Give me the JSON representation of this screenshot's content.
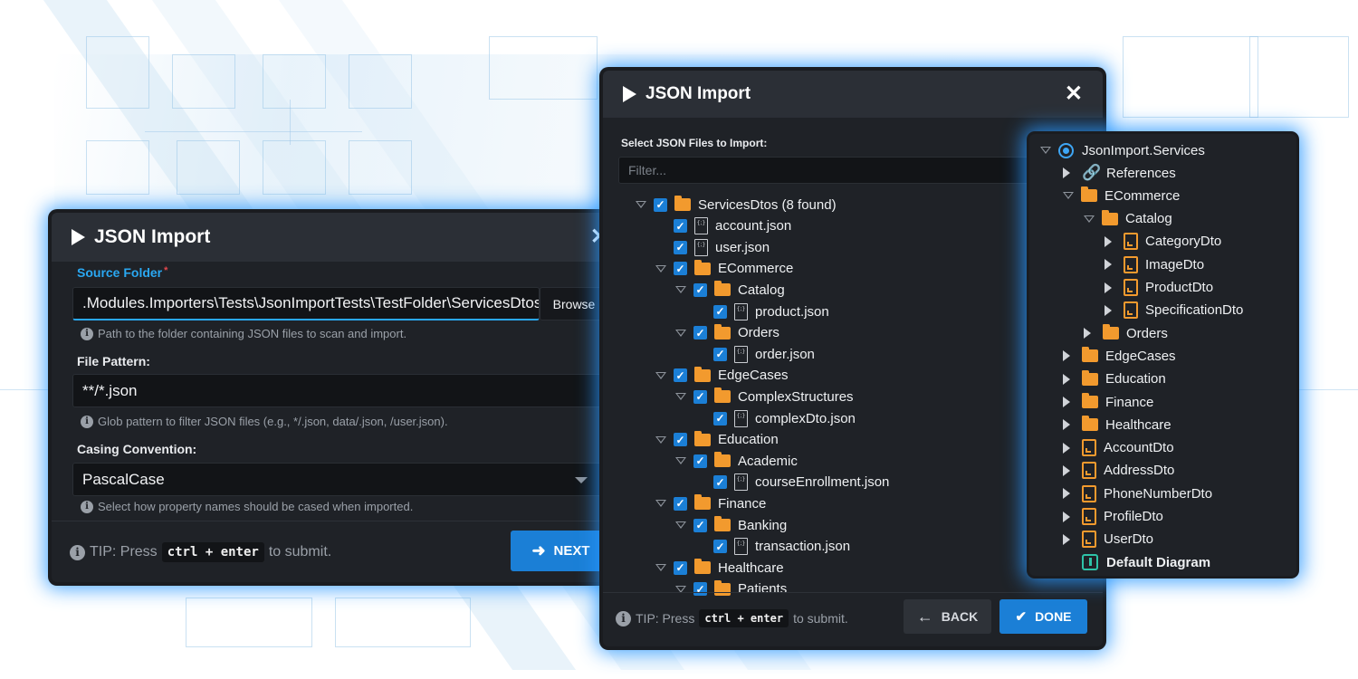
{
  "colors": {
    "accent": "#1b7fd6",
    "glow": "#2896ff",
    "folder": "#f29a2e",
    "required": "#e5484d"
  },
  "dialog_left": {
    "title": "JSON Import",
    "source_folder": {
      "label": "Source Folder",
      "required_mark": "*",
      "value": ".Modules.Importers\\Tests\\JsonImportTests\\TestFolder\\ServicesDtos",
      "browse_label": "Browse",
      "hint": "Path to the folder containing JSON files to scan and import."
    },
    "file_pattern": {
      "label": "File Pattern:",
      "value": "**/*.json",
      "hint": "Glob pattern to filter JSON files (e.g., */.json, data/.json, /user.json)."
    },
    "casing": {
      "label": "Casing Convention:",
      "value": "PascalCase",
      "hint": "Select how property names should be cased when imported."
    },
    "tip": {
      "prefix": "TIP: Press",
      "shortcut": "ctrl + enter",
      "suffix": "to submit."
    },
    "next_label": "NEXT"
  },
  "dialog_middle": {
    "title": "JSON Import",
    "select_label": "Select JSON Files to Import:",
    "filter_placeholder": "Filter...",
    "tree": [
      {
        "label": "ServicesDtos (8 found)",
        "kind": "folder"
      },
      {
        "label": "account.json",
        "kind": "file"
      },
      {
        "label": "user.json",
        "kind": "file"
      },
      {
        "label": "ECommerce",
        "kind": "folder"
      },
      {
        "label": "Catalog",
        "kind": "folder"
      },
      {
        "label": "product.json",
        "kind": "file"
      },
      {
        "label": "Orders",
        "kind": "folder"
      },
      {
        "label": "order.json",
        "kind": "file"
      },
      {
        "label": "EdgeCases",
        "kind": "folder"
      },
      {
        "label": "ComplexStructures",
        "kind": "folder"
      },
      {
        "label": "complexDto.json",
        "kind": "file"
      },
      {
        "label": "Education",
        "kind": "folder"
      },
      {
        "label": "Academic",
        "kind": "folder"
      },
      {
        "label": "courseEnrollment.json",
        "kind": "file"
      },
      {
        "label": "Finance",
        "kind": "folder"
      },
      {
        "label": "Banking",
        "kind": "folder"
      },
      {
        "label": "transaction.json",
        "kind": "file"
      },
      {
        "label": "Healthcare",
        "kind": "folder"
      },
      {
        "label": "Patients",
        "kind": "folder"
      }
    ],
    "tip": {
      "prefix": "TIP: Press",
      "shortcut": "ctrl + enter",
      "suffix": "to submit."
    },
    "back_label": "BACK",
    "done_label": "DONE"
  },
  "panel_right": {
    "root": "JsonImport.Services",
    "items": [
      {
        "label": "References",
        "icon": "link-icon"
      },
      {
        "label": "ECommerce",
        "icon": "folder-icon"
      },
      {
        "label": "Catalog",
        "icon": "folder-icon"
      },
      {
        "label": "CategoryDto",
        "icon": "dto-icon"
      },
      {
        "label": "ImageDto",
        "icon": "dto-icon"
      },
      {
        "label": "ProductDto",
        "icon": "dto-icon"
      },
      {
        "label": "SpecificationDto",
        "icon": "dto-icon"
      },
      {
        "label": "Orders",
        "icon": "folder-icon"
      },
      {
        "label": "EdgeCases",
        "icon": "folder-icon"
      },
      {
        "label": "Education",
        "icon": "folder-icon"
      },
      {
        "label": "Finance",
        "icon": "folder-icon"
      },
      {
        "label": "Healthcare",
        "icon": "folder-icon"
      },
      {
        "label": "AccountDto",
        "icon": "dto-icon"
      },
      {
        "label": "AddressDto",
        "icon": "dto-icon"
      },
      {
        "label": "PhoneNumberDto",
        "icon": "dto-icon"
      },
      {
        "label": "ProfileDto",
        "icon": "dto-icon"
      },
      {
        "label": "UserDto",
        "icon": "dto-icon"
      },
      {
        "label": "Default Diagram",
        "icon": "diagram-icon"
      }
    ]
  }
}
